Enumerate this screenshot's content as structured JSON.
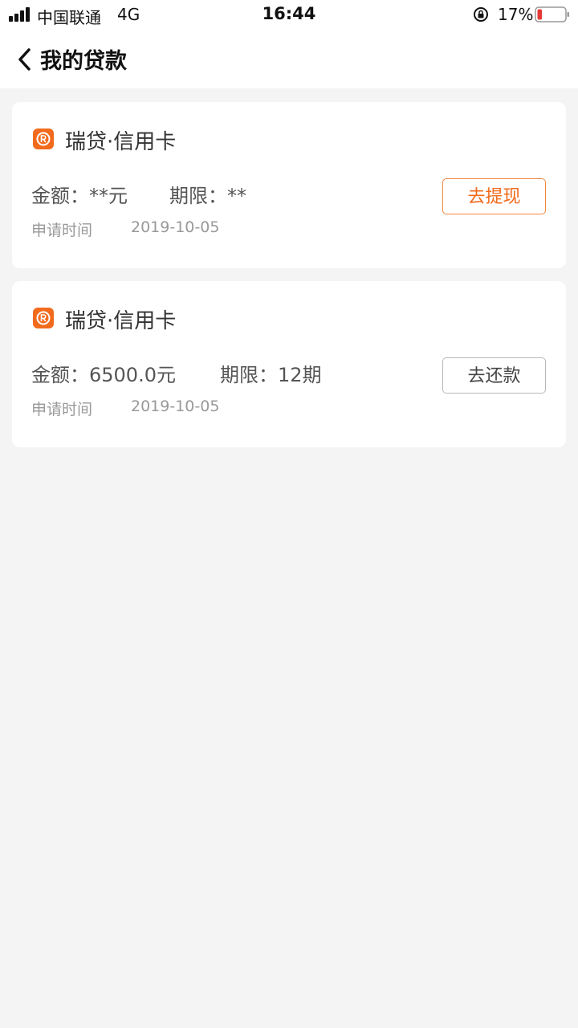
{
  "status_bar": {
    "carrier": "中国联通",
    "network": "4G",
    "time": "16:44",
    "battery": "17%",
    "battery_level": 0.17,
    "battery_color": "#e53935"
  },
  "nav": {
    "title": "我的贷款"
  },
  "colors": {
    "accent": "#f06a1b",
    "background": "#f4f4f4"
  },
  "loans": [
    {
      "title": "瑞贷·信用卡",
      "amount_label": "金额：",
      "amount": "**元",
      "term_label": "期限：",
      "term": "**",
      "apply_label": "申请时间",
      "apply_date": "2019-10-05",
      "action_label": "去提现"
    },
    {
      "title": "瑞贷·信用卡",
      "amount_label": "金额：",
      "amount": "6500.0元",
      "term_label": "期限：",
      "term": "12期",
      "apply_label": "申请时间",
      "apply_date": "2019-10-05",
      "action_label": "去还款"
    }
  ]
}
